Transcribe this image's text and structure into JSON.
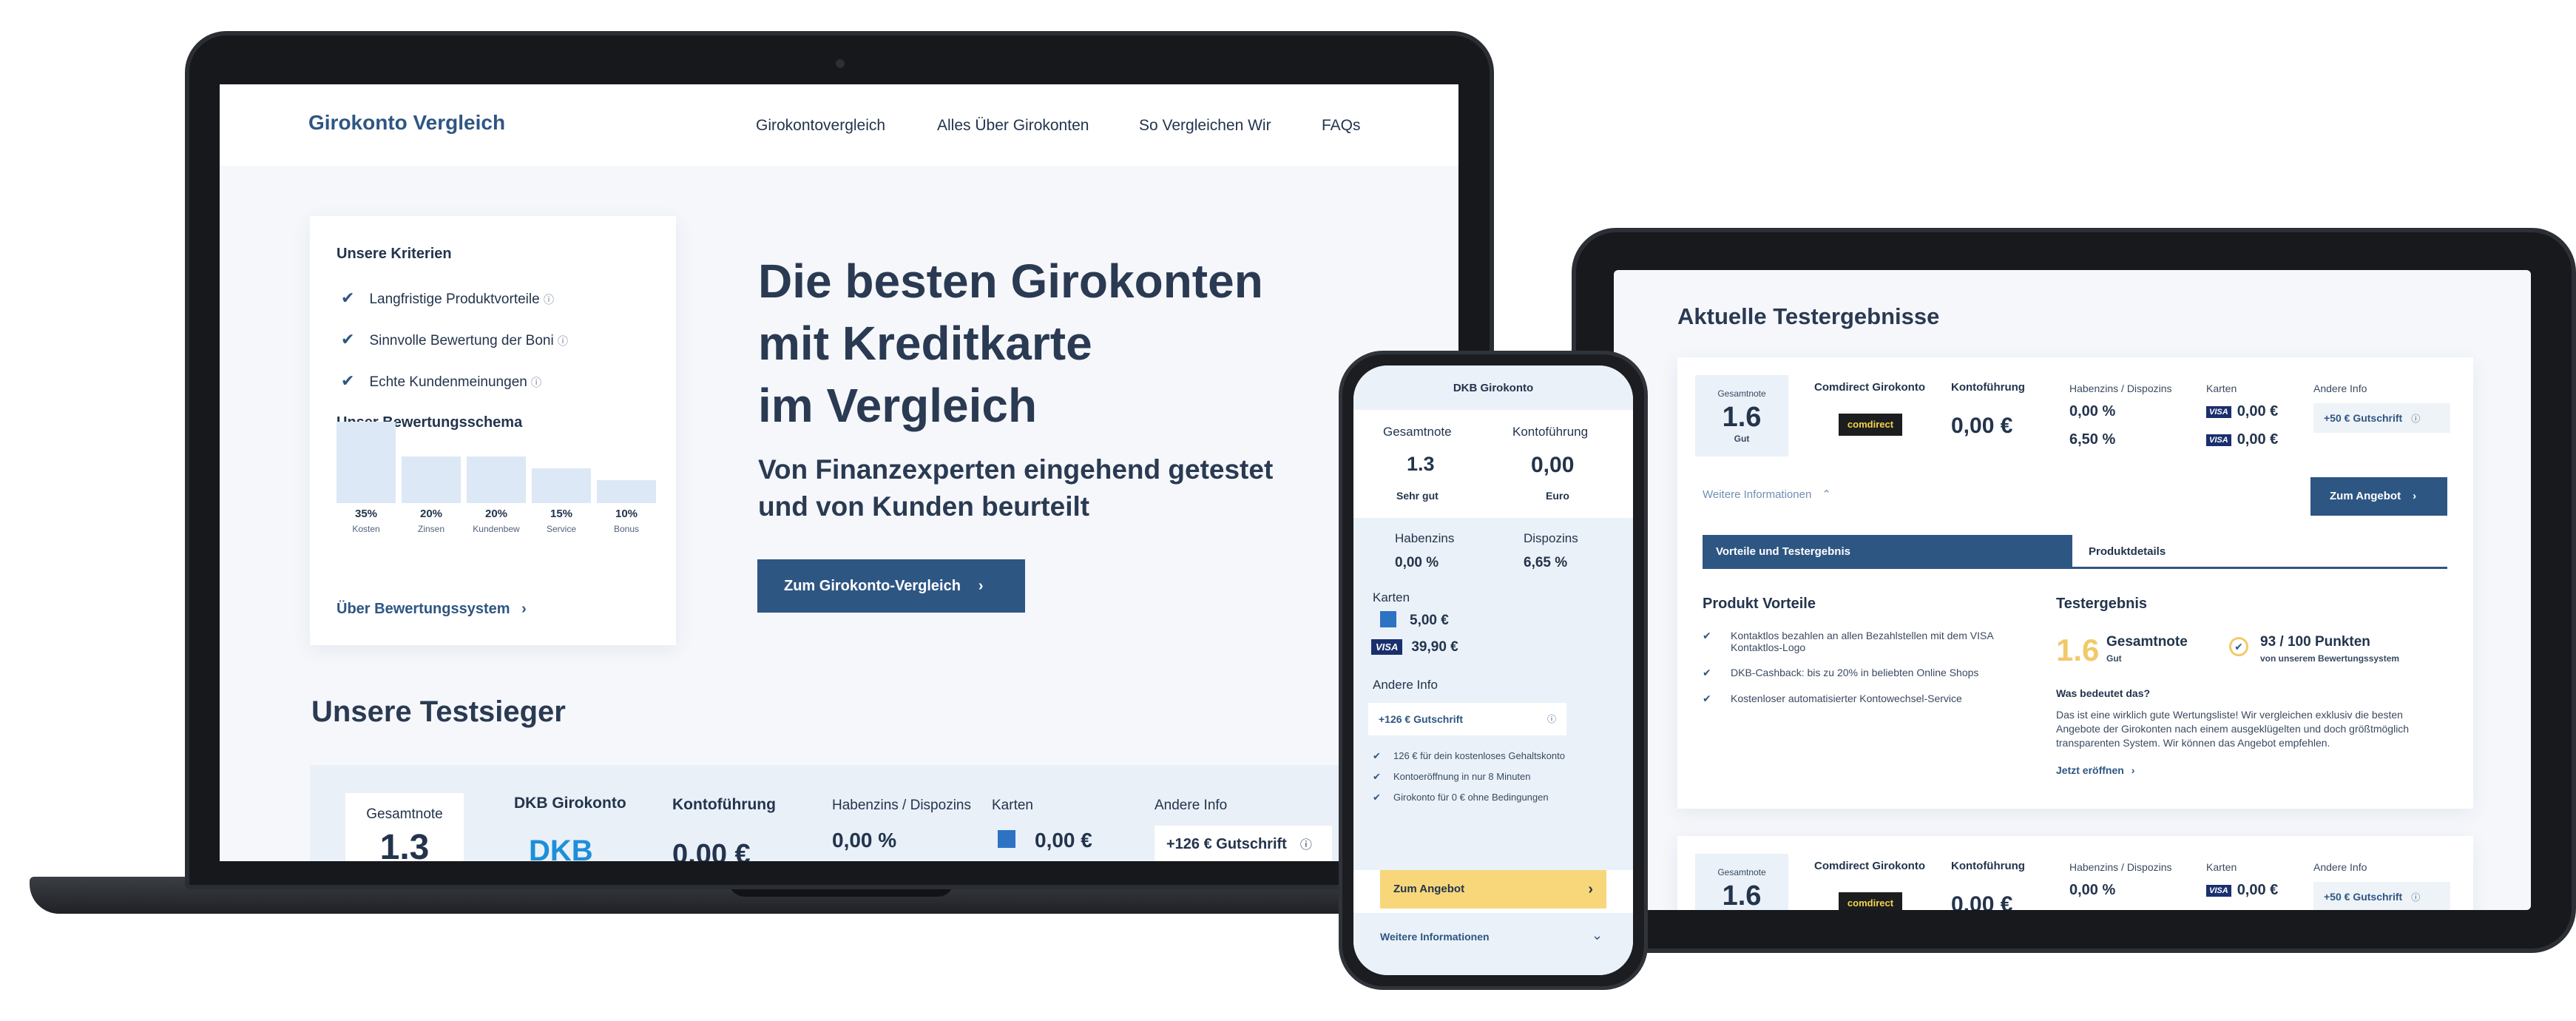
{
  "laptop": {
    "logo": "Girokonto Vergleich",
    "nav": [
      "Girokontovergleich",
      "Alles Über Girokonten",
      "So Vergleichen Wir",
      "FAQs"
    ],
    "criteria_title": "Unsere Kriterien",
    "criteria": [
      "Langfristige Produktvorteile",
      "Sinnvolle Bewertung der Boni",
      "Echte Kundenmeinungen"
    ],
    "schema_title": "Unser Bewertungsschema",
    "schema": [
      {
        "pct": "35%",
        "label": "Kosten",
        "value": 35
      },
      {
        "pct": "20%",
        "label": "Zinsen",
        "value": 20
      },
      {
        "pct": "20%",
        "label": "Kundenbew",
        "value": 20
      },
      {
        "pct": "15%",
        "label": "Service",
        "value": 15
      },
      {
        "pct": "10%",
        "label": "Bonus",
        "value": 10
      }
    ],
    "schema_link": "Über Bewertungssystem",
    "headline_1": "Die besten Girokonten",
    "headline_2": "mit Kreditkarte",
    "headline_3": "im Vergleich",
    "subheadline_1": "Von Finanzexperten eingehend getestet",
    "subheadline_2": "und von Kunden beurteilt",
    "cta": "Zum Girokonto-Vergleich",
    "section_title": "Unsere Testsieger",
    "row": {
      "score_label": "Gesamtnote",
      "score": "1.3",
      "bank": "DKB Girokonto",
      "bank_logo": "DKB",
      "fee_label": "Kontoführung",
      "fee": "0,00 €",
      "interest_label": "Habenzins / Dispozins",
      "interest": "0,00 %",
      "cards_label": "Karten",
      "card_value": "0,00 €",
      "info_label": "Andere Info",
      "info": "+126 € Gutschrift"
    }
  },
  "tablet": {
    "title": "Aktuelle Testergebnisse",
    "card": {
      "score_label": "Gesamtnote",
      "score": "1.6",
      "grade": "Gut",
      "bank": "Comdirect Girokonto",
      "bank_logo": "comdirect",
      "fee_label": "Kontoführung",
      "fee": "0,00 €",
      "interest_label": "Habenzins / Dispozins",
      "interest_1": "0,00 %",
      "interest_2": "6,50 %",
      "cards_label": "Karten",
      "card_1": "0,00 €",
      "card_2": "0,00 €",
      "card_brand": "VISA",
      "info_label": "Andere Info",
      "info": "+50 € Gutschrift",
      "more": "Weitere Informationen",
      "offer_button": "Zum Angebot",
      "tab_1": "Vorteile und Testergebnis",
      "tab_2": "Produktdetails",
      "advantages_title": "Produkt Vorteile",
      "advantages": [
        "Kontaktlos bezahlen an allen Bezahlstellen mit dem VISA Kontaktlos-Logo",
        "DKB-Cashback: bis zu 20% in beliebten Online Shops",
        "Kostenloser automatisierter Kontowechsel-Service"
      ],
      "result_title": "Testergebnis",
      "result_score": "1.6",
      "result_label": "Gesamtnote",
      "result_grade": "Gut",
      "points": "93 / 100 Punkten",
      "points_sub": "von unserem Bewertungssystem",
      "meaning_title": "Was bedeutet das?",
      "meaning_text": "Das ist eine wirklich gute Wertungsliste! Wir vergleichen exklusiv die besten Angebote der Girokonten nach einem ausgeklügelten und doch größtmöglich transparenten System. Wir können das Angebot empfehlen.",
      "open_link": "Jetzt eröffnen"
    },
    "card2": {
      "score_label": "Gesamtnote",
      "score": "1.6",
      "bank": "Comdirect Girokonto",
      "bank_logo": "comdirect",
      "fee_label": "Kontoführung",
      "fee": "0,00 €",
      "interest_label": "Habenzins / Dispozins",
      "interest_1": "0,00 %",
      "cards_label": "Karten",
      "card_1": "0,00 €",
      "card_brand": "VISA",
      "info_label": "Andere Info",
      "info": "+50 € Gutschrift"
    }
  },
  "phone": {
    "bank": "DKB Girokonto",
    "score_label": "Gesamtnote",
    "score": "1.3",
    "grade": "Sehr gut",
    "fee_label": "Kontoführung",
    "fee": "0,00",
    "fee_unit": "Euro",
    "interest_label": "Habenzins",
    "interest": "0,00 %",
    "dispo_label": "Dispozins",
    "dispo": "6,65 %",
    "cards_label": "Karten",
    "card_1": "5,00 €",
    "card_2": "39,90 €",
    "card_brand": "VISA",
    "info_label": "Andere Info",
    "info": "+126 € Gutschrift",
    "benefits": [
      "126 € für dein kostenloses Gehaltskonto",
      "Kontoeröffnung in nur 8 Minuten",
      "Girokonto für 0 € ohne Bedingungen"
    ],
    "offer_button": "Zum Angebot",
    "more": "Weitere Informationen"
  }
}
